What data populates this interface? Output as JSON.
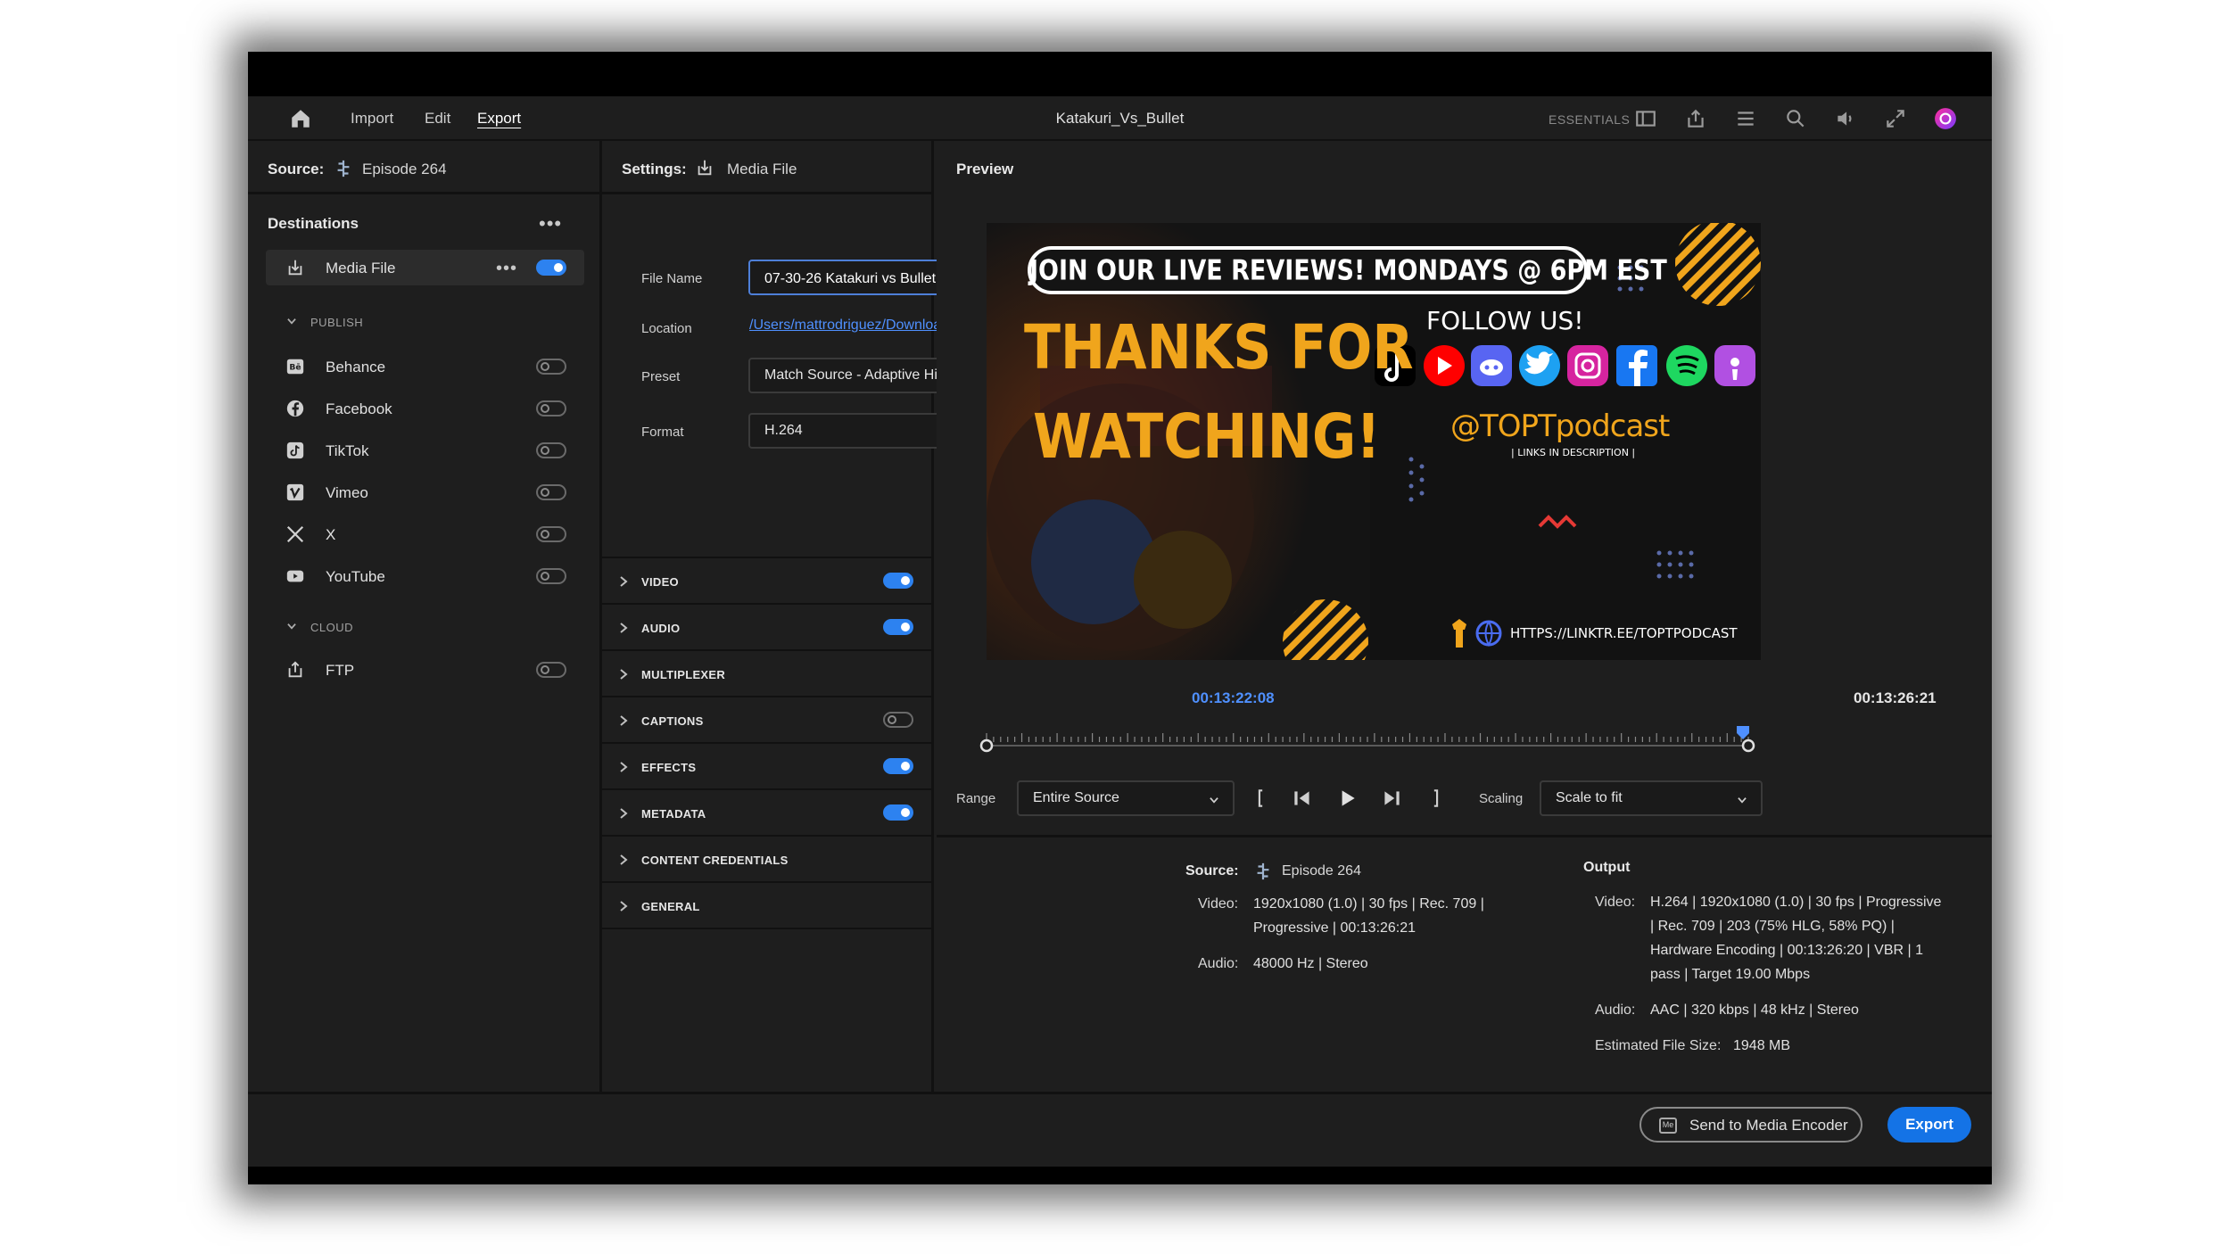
{
  "menubar": {
    "items": [
      {
        "label": "Import"
      },
      {
        "label": "Edit"
      },
      {
        "label": "Export"
      }
    ],
    "document_title": "Katakuri_Vs_Bullet",
    "workspace_label": "ESSENTIALS"
  },
  "source": {
    "label": "Source:",
    "sequence": "Episode 264"
  },
  "destinations": {
    "title": "Destinations",
    "media_file": {
      "label": "Media File",
      "enabled": true
    },
    "publish": {
      "label": "PUBLISH",
      "items": [
        {
          "label": "Behance",
          "enabled": false
        },
        {
          "label": "Facebook",
          "enabled": false
        },
        {
          "label": "TikTok",
          "enabled": false
        },
        {
          "label": "Vimeo",
          "enabled": false
        },
        {
          "label": "X",
          "enabled": false
        },
        {
          "label": "YouTube",
          "enabled": false
        }
      ]
    },
    "cloud": {
      "label": "CLOUD",
      "items": [
        {
          "label": "FTP",
          "enabled": false
        }
      ]
    }
  },
  "settings": {
    "label": "Settings:",
    "target": "Media File",
    "file_name_label": "File Name",
    "file_name_value": "07-30-26 Katakuri vs Bullet",
    "location_label": "Location",
    "location_value": "/Users/mattrodriguez/Downloads/",
    "preset_label": "Preset",
    "preset_value": "Match Source - Adaptive High Bitrate",
    "format_label": "Format",
    "format_value": "H.264",
    "sections": [
      {
        "label": "VIDEO",
        "toggle": true,
        "enabled": true
      },
      {
        "label": "AUDIO",
        "toggle": true,
        "enabled": true
      },
      {
        "label": "MULTIPLEXER",
        "toggle": false,
        "enabled": false
      },
      {
        "label": "CAPTIONS",
        "toggle": true,
        "enabled": false
      },
      {
        "label": "EFFECTS",
        "toggle": true,
        "enabled": true
      },
      {
        "label": "METADATA",
        "toggle": true,
        "enabled": true
      },
      {
        "label": "CONTENT CREDENTIALS",
        "toggle": false,
        "enabled": false
      },
      {
        "label": "GENERAL",
        "toggle": false,
        "enabled": false
      }
    ]
  },
  "preview": {
    "title": "Preview",
    "frame": {
      "banner": "JOIN OUR LIVE REVIEWS! MONDAYS @ 6PM EST",
      "thanks_line1": "THANKS FOR",
      "thanks_line2": "WATCHING!",
      "follow": "FOLLOW US!",
      "handle": "@TOPTpodcast",
      "links_note": "| LINKS IN DESCRIPTION |",
      "url": "HTTPS://LINKTR.EE/TOPTPODCAST"
    },
    "current_time": "00:13:22:08",
    "duration": "00:13:26:21",
    "range_label": "Range",
    "range_value": "Entire Source",
    "scaling_label": "Scaling",
    "scaling_value": "Scale to fit",
    "playhead_fraction": 0.993
  },
  "summary": {
    "source_label": "Source:",
    "source_name": "Episode 264",
    "source_video_label": "Video:",
    "source_video_line1": "1920x1080 (1.0)  |  30 fps  |  Rec. 709  |",
    "source_video_line2": "Progressive  |  00:13:26:21",
    "source_audio_label": "Audio:",
    "source_audio": "48000 Hz  |  Stereo",
    "output_label": "Output",
    "output_video_label": "Video:",
    "output_video_line1": "H.264  |  1920x1080 (1.0)  |  30 fps  |  Progressive",
    "output_video_line2": "|  Rec. 709  |  203 (75% HLG, 58% PQ)  |",
    "output_video_line3": "Hardware Encoding  |  00:13:26:20  |  VBR  |  1",
    "output_video_line4": "pass  |  Target 19.00 Mbps",
    "output_audio_label": "Audio:",
    "output_audio": "AAC  |  320 kbps  |  48 kHz  |  Stereo",
    "file_size_label": "Estimated File Size:",
    "file_size": "1948 MB"
  },
  "footer": {
    "send_label": "Send to Media Encoder",
    "send_icon_text": "Me",
    "export_label": "Export"
  },
  "colors": {
    "accent": "#1473e6",
    "toggle_on": "#2d82f0",
    "link": "#4f90ff",
    "panel_bg": "#1e1e1e"
  },
  "icons": [
    "home-icon",
    "panel-icon",
    "share-icon",
    "menu-icon",
    "zoom-icon",
    "volume-icon",
    "fullscreen-icon",
    "avatar",
    "sequence-icon",
    "export-icon",
    "behance-icon",
    "facebook-icon",
    "tiktok-icon",
    "vimeo-icon",
    "x-icon",
    "youtube-icon",
    "upload-icon",
    "play-icon",
    "step-back-icon",
    "step-forward-icon"
  ]
}
